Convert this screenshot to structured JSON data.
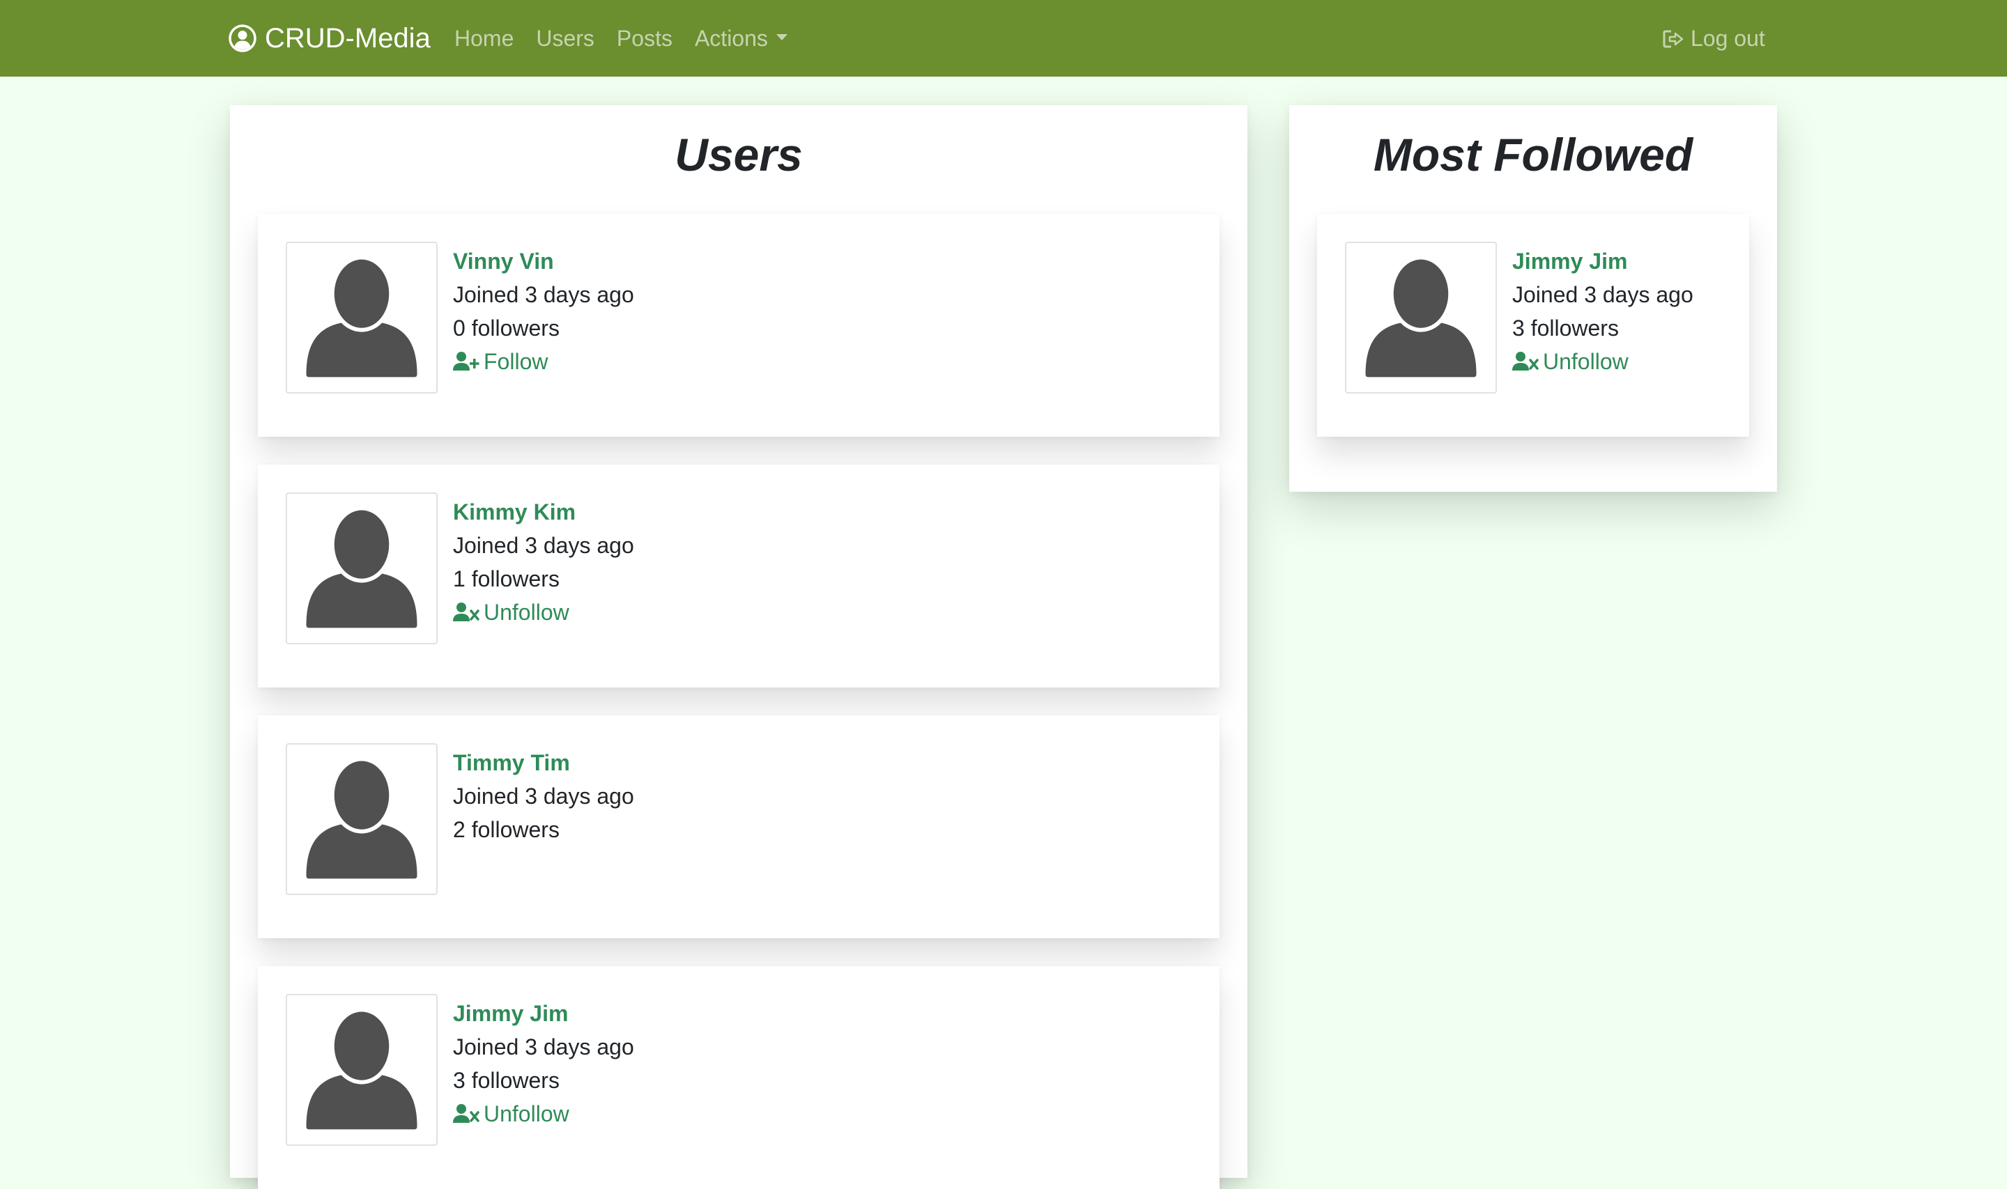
{
  "navbar": {
    "brand": "CRUD-Media",
    "links": [
      "Home",
      "Users",
      "Posts"
    ],
    "actions_label": "Actions",
    "logout_label": "Log out",
    "background": "#6b8e2f"
  },
  "users_panel": {
    "title": "Users",
    "users": [
      {
        "name": "Vinny Vin",
        "joined": "Joined 3 days ago",
        "followers": "0 followers",
        "action": "Follow",
        "action_icon": "user-plus-icon"
      },
      {
        "name": "Kimmy Kim",
        "joined": "Joined 3 days ago",
        "followers": "1 followers",
        "action": "Unfollow",
        "action_icon": "user-xmark-icon"
      },
      {
        "name": "Timmy Tim",
        "joined": "Joined 3 days ago",
        "followers": "2 followers",
        "action": "",
        "action_icon": ""
      },
      {
        "name": "Jimmy Jim",
        "joined": "Joined 3 days ago",
        "followers": "3 followers",
        "action": "Unfollow",
        "action_icon": "user-xmark-icon"
      }
    ]
  },
  "most_followed_panel": {
    "title": "Most Followed",
    "users": [
      {
        "name": "Jimmy Jim",
        "joined": "Joined 3 days ago",
        "followers": "3 followers",
        "action": "Unfollow",
        "action_icon": "user-xmark-icon"
      }
    ]
  },
  "colors": {
    "page_background": "#f0fff0",
    "accent_green": "#2e8b57",
    "avatar_gray": "#505050"
  }
}
